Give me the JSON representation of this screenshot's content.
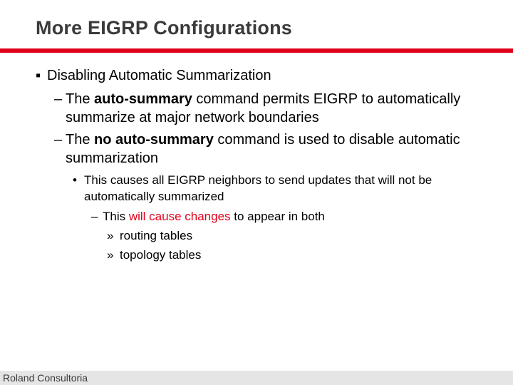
{
  "title": "More EIGRP Configurations",
  "bullets": {
    "l1": "Disabling Automatic Summarization",
    "l2a_pre": "The ",
    "l2a_bold": "auto-summary",
    "l2a_post": " command permits EIGRP to automatically summarize at major network boundaries",
    "l2b_pre": "The ",
    "l2b_bold": "no auto-summary",
    "l2b_post": " command is used to disable automatic summarization",
    "l3": "This causes all EIGRP neighbors to send updates that will not be automatically summarized",
    "l4_pre": "This ",
    "l4_mid": "will cause changes",
    "l4_post": " to appear in both",
    "l5a": "routing tables",
    "l5b": "topology tables"
  },
  "footer": "Roland Consultoria",
  "markers": {
    "square": "▪",
    "dash": "–",
    "dot": "•",
    "raquo": "»"
  }
}
